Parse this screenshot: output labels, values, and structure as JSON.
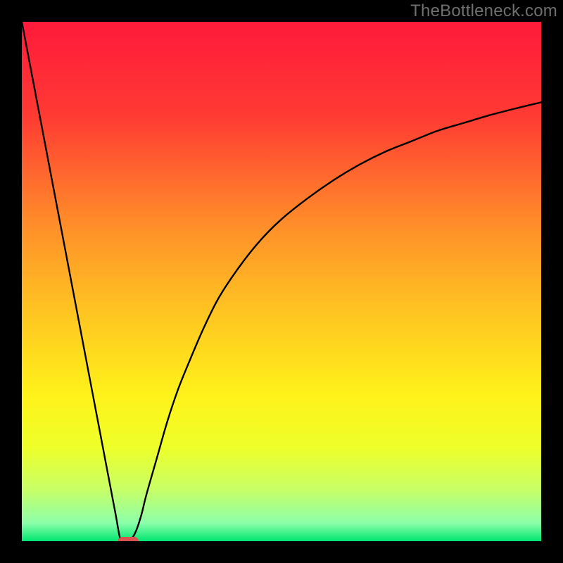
{
  "watermark": "TheBottleneck.com",
  "chart_data": {
    "type": "line",
    "title": "",
    "xlabel": "",
    "ylabel": "",
    "xlim": [
      0,
      100
    ],
    "ylim": [
      0,
      100
    ],
    "x": [
      0,
      2,
      4,
      6,
      8,
      10,
      12,
      14,
      16,
      18,
      19,
      20,
      21,
      22,
      23,
      24,
      26,
      28,
      30,
      32,
      35,
      38,
      42,
      46,
      50,
      55,
      60,
      65,
      70,
      75,
      80,
      85,
      90,
      95,
      100
    ],
    "values": [
      100,
      89.5,
      79,
      68.5,
      58,
      47.5,
      37,
      26.5,
      16,
      5.5,
      0.3,
      0,
      0.3,
      2,
      5,
      9,
      16,
      23,
      29,
      34,
      41,
      47,
      53,
      58,
      62,
      66,
      69.5,
      72.5,
      75,
      77,
      79,
      80.5,
      82,
      83.3,
      84.5
    ],
    "marker": {
      "x_range": [
        18.5,
        22.5
      ],
      "y": 0,
      "color": "#d9534f"
    },
    "background_gradient": {
      "stops": [
        {
          "offset": 0.0,
          "color": "#ff1a3b"
        },
        {
          "offset": 0.18,
          "color": "#ff3a33"
        },
        {
          "offset": 0.38,
          "color": "#ff8a2a"
        },
        {
          "offset": 0.55,
          "color": "#ffc222"
        },
        {
          "offset": 0.72,
          "color": "#fff21a"
        },
        {
          "offset": 0.82,
          "color": "#eeff2a"
        },
        {
          "offset": 0.9,
          "color": "#c8ff66"
        },
        {
          "offset": 0.965,
          "color": "#8cffaa"
        },
        {
          "offset": 1.0,
          "color": "#00e670"
        }
      ]
    }
  }
}
